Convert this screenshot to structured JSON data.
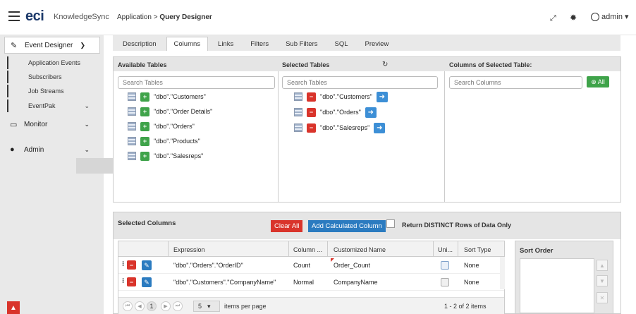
{
  "header": {
    "logo": "eci",
    "product": "KnowledgeSync",
    "breadcrumb_parent": "Application > ",
    "breadcrumb_current": "Query Designer",
    "user": "admin"
  },
  "sidebar": {
    "event_designer": "Event Designer",
    "sub_items": [
      "Application Events",
      "Subscribers",
      "Job Streams",
      "EventPak"
    ],
    "monitor": "Monitor",
    "admin": "Admin"
  },
  "tabs": [
    "Description",
    "Columns",
    "Links",
    "Filters",
    "Sub Filters",
    "SQL",
    "Preview"
  ],
  "active_tab": "Columns",
  "available": {
    "title": "Available Tables",
    "placeholder": "Search Tables",
    "tables": [
      "\"dbo\".\"Customers\"",
      "\"dbo\".\"Order Details\"",
      "\"dbo\".\"Orders\"",
      "\"dbo\".\"Products\"",
      "\"dbo\".\"Salesreps\""
    ]
  },
  "selected_tables": {
    "title": "Selected Tables",
    "placeholder": "Search Tables",
    "tables": [
      "\"dbo\".\"Customers\"",
      "\"dbo\".\"Orders\"",
      "\"dbo\".\"Salesreps\""
    ]
  },
  "columns_panel": {
    "title": "Columns of Selected Table:",
    "placeholder": "Search Columns",
    "all_label": "All"
  },
  "selected_columns": {
    "title": "Selected Columns",
    "clear_all": "Clear All",
    "add_calculated": "Add Calculated Column",
    "distinct_label": "Return DISTINCT Rows of Data Only",
    "headers": [
      "Expression",
      "Column ...",
      "Customized Name",
      "Uni...",
      "Sort Type"
    ],
    "rows": [
      {
        "expression": "\"dbo\".\"Orders\".\"OrderID\"",
        "column": "Count",
        "name": "Order_Count",
        "sort": "None"
      },
      {
        "expression": "\"dbo\".\"Customers\".\"CompanyName\"",
        "column": "Normal",
        "name": "CompanyName",
        "sort": "None"
      }
    ],
    "page": "1",
    "page_size": "5",
    "items_per_page": "items per page",
    "count": "1 - 2 of 2 items"
  },
  "sort_order": {
    "title": "Sort Order"
  }
}
